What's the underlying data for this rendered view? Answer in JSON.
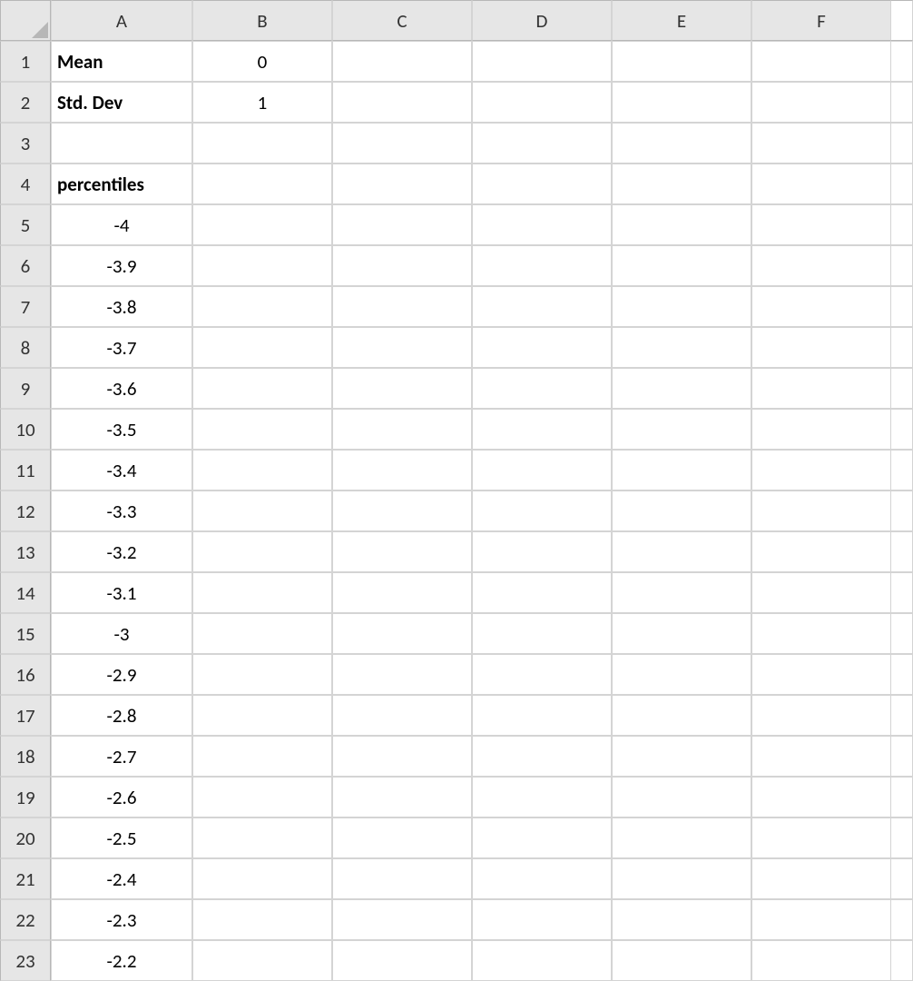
{
  "columns": [
    "A",
    "B",
    "C",
    "D",
    "E",
    "F"
  ],
  "rows": [
    "1",
    "2",
    "3",
    "4",
    "5",
    "6",
    "7",
    "8",
    "9",
    "10",
    "11",
    "12",
    "13",
    "14",
    "15",
    "16",
    "17",
    "18",
    "19",
    "20",
    "21",
    "22",
    "23"
  ],
  "cells": {
    "A1": {
      "value": "Mean",
      "bold": true,
      "align": "left"
    },
    "B1": {
      "value": "0",
      "bold": false,
      "align": "center"
    },
    "A2": {
      "value": "Std. Dev",
      "bold": true,
      "align": "left"
    },
    "B2": {
      "value": "1",
      "bold": false,
      "align": "center"
    },
    "A4": {
      "value": "percentiles",
      "bold": true,
      "align": "left"
    },
    "A5": {
      "value": "-4",
      "bold": false,
      "align": "center"
    },
    "A6": {
      "value": "-3.9",
      "bold": false,
      "align": "center"
    },
    "A7": {
      "value": "-3.8",
      "bold": false,
      "align": "center"
    },
    "A8": {
      "value": "-3.7",
      "bold": false,
      "align": "center"
    },
    "A9": {
      "value": "-3.6",
      "bold": false,
      "align": "center"
    },
    "A10": {
      "value": "-3.5",
      "bold": false,
      "align": "center"
    },
    "A11": {
      "value": "-3.4",
      "bold": false,
      "align": "center"
    },
    "A12": {
      "value": "-3.3",
      "bold": false,
      "align": "center"
    },
    "A13": {
      "value": "-3.2",
      "bold": false,
      "align": "center"
    },
    "A14": {
      "value": "-3.1",
      "bold": false,
      "align": "center"
    },
    "A15": {
      "value": "-3",
      "bold": false,
      "align": "center"
    },
    "A16": {
      "value": "-2.9",
      "bold": false,
      "align": "center"
    },
    "A17": {
      "value": "-2.8",
      "bold": false,
      "align": "center"
    },
    "A18": {
      "value": "-2.7",
      "bold": false,
      "align": "center"
    },
    "A19": {
      "value": "-2.6",
      "bold": false,
      "align": "center"
    },
    "A20": {
      "value": "-2.5",
      "bold": false,
      "align": "center"
    },
    "A21": {
      "value": "-2.4",
      "bold": false,
      "align": "center"
    },
    "A22": {
      "value": "-2.3",
      "bold": false,
      "align": "center"
    },
    "A23": {
      "value": "-2.2",
      "bold": false,
      "align": "center"
    }
  }
}
